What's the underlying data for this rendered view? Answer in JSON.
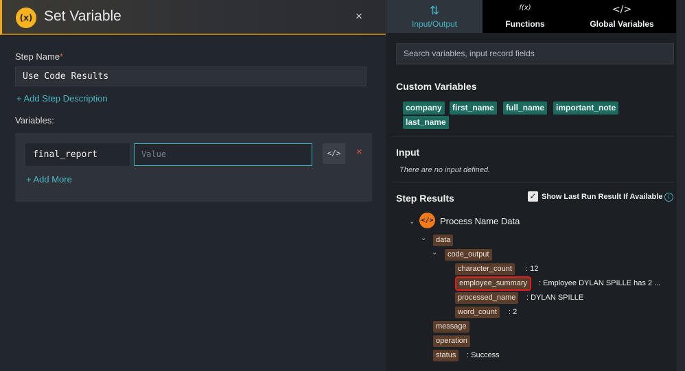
{
  "header": {
    "icon_text": "(x)",
    "title": "Set Variable",
    "close": "×"
  },
  "form": {
    "step_name_label": "Step Name",
    "required_mark": "*",
    "step_name_value": "Use Code Results",
    "add_description": "+ Add Step Description",
    "variables_label": "Variables:",
    "variable_name": "final_report",
    "variable_value_placeholder": "Value",
    "code_button": "</>",
    "delete": "×",
    "add_more": "+ Add More"
  },
  "tabs": [
    {
      "icon": "⇅",
      "label": "Input/Output",
      "active": true
    },
    {
      "icon": "f(x)",
      "label": "Functions",
      "active": false
    },
    {
      "icon": "</>",
      "label": "Global Variables",
      "active": false
    }
  ],
  "search": {
    "placeholder": "Search variables, input record fields"
  },
  "custom_variables": {
    "title": "Custom Variables",
    "chips": [
      "company",
      "first_name",
      "full_name",
      "important_note",
      "last_name"
    ]
  },
  "input": {
    "title": "Input",
    "empty_text": "There are no input defined."
  },
  "step_results": {
    "title": "Step Results",
    "show_last_run_label": "Show Last Run Result If Available",
    "show_last_run_checked": true,
    "process_name": "Process Name Data",
    "process_icon": "</>",
    "tree": {
      "data": "data",
      "code_output": "code_output",
      "fields": [
        {
          "key": "character_count",
          "value": ": 12"
        },
        {
          "key": "employee_summary",
          "value": ": Employee DYLAN SPILLE has 2 ..."
        },
        {
          "key": "processed_name",
          "value": ": DYLAN SPILLE"
        },
        {
          "key": "word_count",
          "value": ": 2"
        }
      ],
      "message": "message",
      "operation": "operation",
      "status_key": "status",
      "status_value": ": Success"
    }
  },
  "colors": {
    "accent": "#41b5c4",
    "brand": "#f6b21f",
    "chip": "#1d6b5e",
    "key": "#5a3d2b",
    "highlight": "#e81a1a"
  }
}
